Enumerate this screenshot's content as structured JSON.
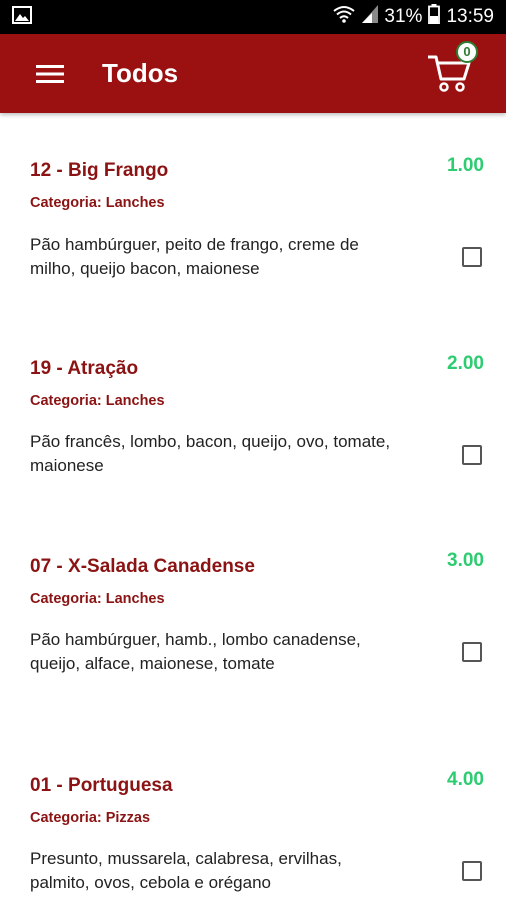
{
  "status_bar": {
    "battery": "31%",
    "time": "13:59"
  },
  "app_bar": {
    "title": "Todos",
    "cart_count": "0"
  },
  "items": [
    {
      "name": "12 - Big Frango",
      "price": "1.00",
      "category": "Categoria: Lanches",
      "description": "Pão hambúrguer, peito de frango, creme de milho, queijo bacon, maionese",
      "checked": false
    },
    {
      "name": "19 - Atração",
      "price": "2.00",
      "category": "Categoria: Lanches",
      "description": "Pão francês, lombo, bacon, queijo, ovo, tomate, maionese",
      "checked": false
    },
    {
      "name": "07 - X-Salada Canadense",
      "price": "3.00",
      "category": "Categoria: Lanches",
      "description": "Pão hambúrguer, hamb., lombo canadense, queijo, alface, maionese, tomate",
      "checked": false
    },
    {
      "name": "01 - Portuguesa",
      "price": "4.00",
      "category": "Categoria: Pizzas",
      "description": "Presunto, mussarela, calabresa, ervilhas, palmito, ovos, cebola e orégano",
      "checked": false
    }
  ],
  "colors": {
    "app_bar": "#9b1111",
    "accent_text": "#8b1313",
    "price": "#2ecc71",
    "badge": "#2e7d32"
  },
  "icons": [
    "image-icon",
    "wifi-icon",
    "signal-icon",
    "battery-icon",
    "menu-icon",
    "cart-icon"
  ]
}
